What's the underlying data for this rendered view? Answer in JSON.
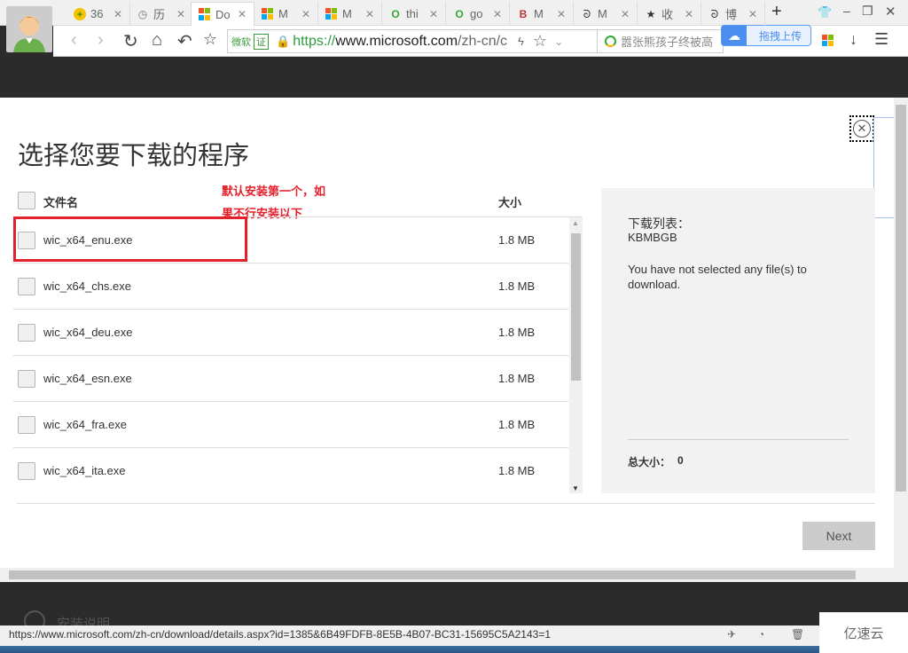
{
  "browser": {
    "tabs": [
      {
        "label": "36",
        "icon": "360-icon"
      },
      {
        "label": "历",
        "icon": "history-clock-icon"
      },
      {
        "label": "Do",
        "icon": "microsoft-logo-icon",
        "active": true
      },
      {
        "label": "M",
        "icon": "microsoft-logo-icon"
      },
      {
        "label": "M",
        "icon": "microsoft-logo-icon"
      },
      {
        "label": "thi",
        "icon": "search-o-icon"
      },
      {
        "label": "go",
        "icon": "search-o-icon"
      },
      {
        "label": "M",
        "icon": "b-logo-icon"
      },
      {
        "label": "M",
        "icon": "bird-icon"
      },
      {
        "label": "收",
        "icon": "star-icon"
      },
      {
        "label": "博",
        "icon": "bird-icon"
      }
    ],
    "new_tab": "+",
    "cert_label": "微软",
    "cert_badge": "证",
    "url_scheme": "https://",
    "url_host": "www.microsoft.com",
    "url_path": "/zh-cn/c",
    "search_text": "嚣张熊孩子终被高",
    "upload_label": "拖拽上传",
    "status_url": "https://www.microsoft.com/zh-cn/download/details.aspx?id=1385&6B49FDFB-8E5B-4B07-BC31-15695C5A2143=1",
    "watermark": "亿速云"
  },
  "dialog": {
    "title": "选择您要下载的程序",
    "col_name": "文件名",
    "col_size": "大小",
    "annotation_line1": "默认安装第一个，如",
    "annotation_line2": "果不行安装以下",
    "annotation_color": "#e3202b",
    "files": [
      {
        "name": "wic_x64_enu.exe",
        "size": "1.8 MB",
        "checked": false
      },
      {
        "name": "wic_x64_chs.exe",
        "size": "1.8 MB",
        "checked": false
      },
      {
        "name": "wic_x64_deu.exe",
        "size": "1.8 MB",
        "checked": false
      },
      {
        "name": "wic_x64_esn.exe",
        "size": "1.8 MB",
        "checked": false
      },
      {
        "name": "wic_x64_fra.exe",
        "size": "1.8 MB",
        "checked": false
      },
      {
        "name": "wic_x64_ita.exe",
        "size": "1.8 MB",
        "checked": false
      }
    ],
    "panel_title": "下载列表：",
    "panel_sub": "KBMBGB",
    "panel_msg": "You have not selected any file(s) to download.",
    "total_label": "总大小：",
    "total_value": "0",
    "next_label": "Next"
  },
  "background_page": {
    "item2": "安装说明"
  }
}
